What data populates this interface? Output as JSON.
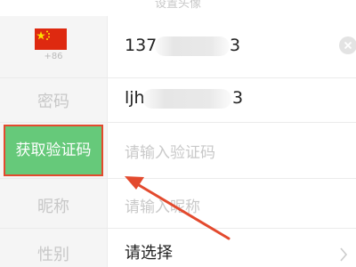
{
  "header": {
    "title": "设置头像"
  },
  "phone_row": {
    "country_code": "+86",
    "flag": "china-flag",
    "value_prefix": "137",
    "value_suffix": "3",
    "clear_icon": "clear-icon"
  },
  "password_row": {
    "label": "密码",
    "value_prefix": "ljh",
    "value_suffix": "3"
  },
  "code_row": {
    "button_label": "获取验证码",
    "placeholder": "请输入验证码"
  },
  "nickname_row": {
    "label": "昵称",
    "placeholder": "请输入昵称"
  },
  "gender_row": {
    "label": "性别",
    "value": "请选择",
    "chevron": "chevron-right-icon"
  },
  "colors": {
    "button_green": "#66c97a",
    "highlight_red": "#e34a2e"
  }
}
